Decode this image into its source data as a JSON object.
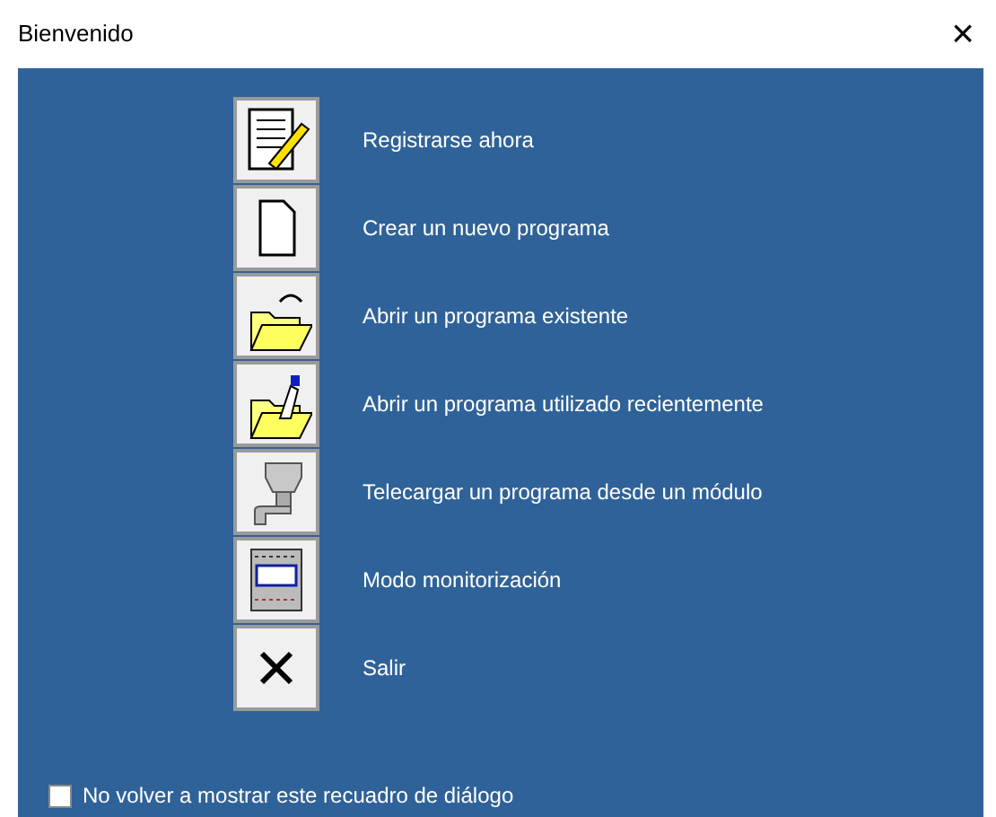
{
  "window": {
    "title": "Bienvenido",
    "close": "×"
  },
  "actions": [
    {
      "kind": "register",
      "label": "Registrarse ahora"
    },
    {
      "kind": "new",
      "label": "Crear un nuevo programa"
    },
    {
      "kind": "open",
      "label": "Abrir un programa existente"
    },
    {
      "kind": "recent",
      "label": "Abrir un programa utilizado recientemente"
    },
    {
      "kind": "download",
      "label": "Telecargar un programa desde un módulo"
    },
    {
      "kind": "monitor",
      "label": "Modo monitorización"
    },
    {
      "kind": "exit",
      "label": "Salir"
    }
  ],
  "dont_show_again": {
    "label": "No volver a mostrar este recuadro de diálogo",
    "checked": false
  }
}
